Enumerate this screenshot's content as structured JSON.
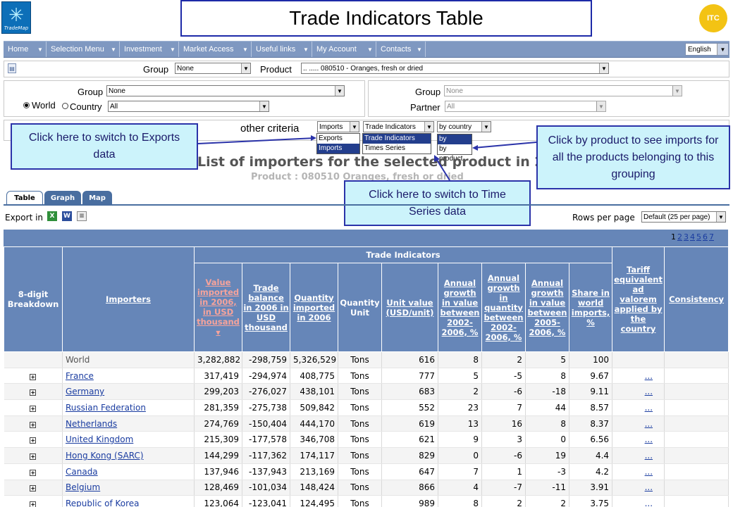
{
  "header": {
    "logo_text": "TradeMap",
    "banner_title": "Trade Indicators Table",
    "itc_text": "ITC"
  },
  "nav": {
    "items": [
      "Home",
      "Selection Menu",
      "Investment",
      "Market Access",
      "Useful links",
      "My Account",
      "Contacts"
    ],
    "language": "English"
  },
  "product_row": {
    "group_label": "Group",
    "group_value": "None",
    "product_label": "Product",
    "product_value": ".. ..... 080510 - Oranges, fresh or dried"
  },
  "reporter": {
    "group_label": "Group",
    "group_value": "None",
    "world_label": "World",
    "country_label": "Country",
    "country_value": "All"
  },
  "partner": {
    "group_label": "Group",
    "group_value": "None",
    "partner_label": "Partner",
    "partner_value": "All"
  },
  "criteria": {
    "label": "other criteria",
    "flow_value": "Imports",
    "flow_options": [
      "Exports",
      "Imports"
    ],
    "indicator_value": "Trade Indicators",
    "indicator_options": [
      "Trade Indicators",
      "Times Series"
    ],
    "by_value": "by country",
    "by_options": [
      "by country",
      "by product"
    ]
  },
  "callouts": {
    "exports": "Click here to switch to Exports data",
    "byproduct": "Click by product to see imports for all the products belonging to this grouping",
    "timeseries": "Click here to switch to Time Series data"
  },
  "page": {
    "title": "List of importers for the selected product in 2006",
    "subtitle": "Product : 080510 Oranges, fresh or dried"
  },
  "tabs": [
    "Table",
    "Graph",
    "Map"
  ],
  "export": {
    "label": "Export in",
    "rows_label": "Rows per page",
    "rows_value": "Default (25 per page)"
  },
  "pager": [
    "1",
    "2",
    "3",
    "4",
    "5",
    "6",
    "7"
  ],
  "table": {
    "group_header": "Trade Indicators",
    "col_breakdown": "8-digit Breakdown",
    "col_importers": "Importers",
    "col_value": "Value imported in 2006, in USD thousand",
    "col_balance": "Trade balance in 2006 in USD thousand",
    "col_quantity": "Quantity imported in 2006",
    "col_qunit": "Quantity Unit",
    "col_unitvalue": "Unit value (USD/unit)",
    "col_gvalue": "Annual growth in value between 2002-2006, %",
    "col_gquantity": "Annual growth in quantity between 2002-2006, %",
    "col_gvalue2": "Annual growth in value between 2005-2006, %",
    "col_share": "Share in world imports, %",
    "col_tariff": "Tariff equivalent ad valorem applied by the country",
    "col_consistency": "Consistency",
    "sort_arrow": "▼",
    "rows": [
      {
        "name": "World",
        "value": "3,282,882",
        "balance": "-298,759",
        "quantity": "5,326,529",
        "unit": "Tons",
        "unitvalue": "616",
        "g1": "8",
        "g2": "2",
        "g3": "5",
        "share": "100",
        "tariff": ""
      },
      {
        "name": "France",
        "value": "317,419",
        "balance": "-294,974",
        "quantity": "408,775",
        "unit": "Tons",
        "unitvalue": "777",
        "g1": "5",
        "g2": "-5",
        "g3": "8",
        "share": "9.67",
        "tariff": "..."
      },
      {
        "name": "Germany",
        "value": "299,203",
        "balance": "-276,027",
        "quantity": "438,101",
        "unit": "Tons",
        "unitvalue": "683",
        "g1": "2",
        "g2": "-6",
        "g3": "-18",
        "share": "9.11",
        "tariff": "..."
      },
      {
        "name": "Russian Federation",
        "value": "281,359",
        "balance": "-275,738",
        "quantity": "509,842",
        "unit": "Tons",
        "unitvalue": "552",
        "g1": "23",
        "g2": "7",
        "g3": "44",
        "share": "8.57",
        "tariff": "..."
      },
      {
        "name": "Netherlands",
        "value": "274,769",
        "balance": "-150,404",
        "quantity": "444,170",
        "unit": "Tons",
        "unitvalue": "619",
        "g1": "13",
        "g2": "16",
        "g3": "8",
        "share": "8.37",
        "tariff": "..."
      },
      {
        "name": "United Kingdom",
        "value": "215,309",
        "balance": "-177,578",
        "quantity": "346,708",
        "unit": "Tons",
        "unitvalue": "621",
        "g1": "9",
        "g2": "3",
        "g3": "0",
        "share": "6.56",
        "tariff": "..."
      },
      {
        "name": "Hong Kong (SARC)",
        "value": "144,299",
        "balance": "-117,362",
        "quantity": "174,117",
        "unit": "Tons",
        "unitvalue": "829",
        "g1": "0",
        "g2": "-6",
        "g3": "19",
        "share": "4.4",
        "tariff": "..."
      },
      {
        "name": "Canada",
        "value": "137,946",
        "balance": "-137,943",
        "quantity": "213,169",
        "unit": "Tons",
        "unitvalue": "647",
        "g1": "7",
        "g2": "1",
        "g3": "-3",
        "share": "4.2",
        "tariff": "..."
      },
      {
        "name": "Belgium",
        "value": "128,469",
        "balance": "-101,034",
        "quantity": "148,424",
        "unit": "Tons",
        "unitvalue": "866",
        "g1": "4",
        "g2": "-7",
        "g3": "-11",
        "share": "3.91",
        "tariff": "..."
      },
      {
        "name": "Republic of Korea",
        "value": "123,064",
        "balance": "-123,041",
        "quantity": "124,495",
        "unit": "Tons",
        "unitvalue": "989",
        "g1": "8",
        "g2": "2",
        "g3": "2",
        "share": "3.75",
        "tariff": "..."
      }
    ]
  }
}
